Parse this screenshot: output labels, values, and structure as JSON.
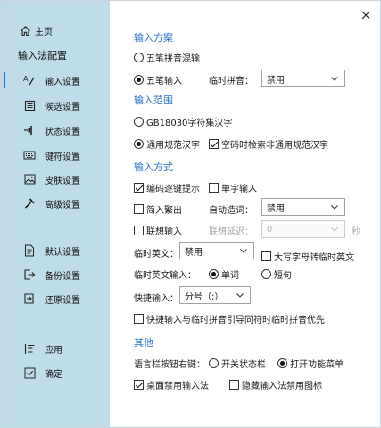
{
  "window": {
    "close_symbol": "×"
  },
  "sidebar": {
    "home": {
      "label": "主页",
      "icon": "home-icon"
    },
    "section_title": "输入法配置",
    "items": [
      {
        "label": "输入设置",
        "icon": "input-settings-icon",
        "active": true
      },
      {
        "label": "候选设置",
        "icon": "candidate-settings-icon"
      },
      {
        "label": "状态设置",
        "icon": "status-settings-icon"
      },
      {
        "label": "键符设置",
        "icon": "keyboard-icon"
      },
      {
        "label": "皮肤设置",
        "icon": "skin-image-icon"
      },
      {
        "label": "高级设置",
        "icon": "hammer-icon"
      }
    ],
    "actions": [
      {
        "label": "默认设置",
        "icon": "default-doc-icon"
      },
      {
        "label": "备份设置",
        "icon": "backup-export-icon"
      },
      {
        "label": "还原设置",
        "icon": "restore-import-icon"
      }
    ],
    "bottom": [
      {
        "label": "应用",
        "icon": "apply-list-icon"
      },
      {
        "label": "确定",
        "icon": "confirm-check-icon"
      }
    ],
    "accent_color": "#1f6fd6",
    "background_color": "#bedcea"
  },
  "scheme": {
    "title": "输入方案",
    "option_mixed": "五笔拼音混输",
    "option_wubi": "五笔输入",
    "temp_pinyin_label": "临时拼音：",
    "temp_pinyin_value": "禁用"
  },
  "range": {
    "title": "输入范围",
    "option_gb18030": "GB18030字符集汉字",
    "option_common": "通用规范汉字",
    "space_search": "空码时检索非通用规范汉字"
  },
  "method": {
    "title": "输入方式",
    "code_hint": "编码逐键提示",
    "single_char": "单字输入",
    "simplified_traditional": "简入繁出",
    "auto_create_word_label": "自动造词：",
    "auto_create_word_value": "禁用",
    "association": "联想输入",
    "association_delay_label": "联想延迟：",
    "association_delay_value": "0",
    "association_delay_unit": "秒",
    "temp_english_label": "临时英文：",
    "temp_english_value": "禁用",
    "caps_temp_english": "大写字母转临时英文",
    "temp_english_input_label": "临时英文输入：",
    "option_word": "单词",
    "option_phrase": "短句",
    "quick_input_label": "快捷输入：",
    "quick_input_value": "分号（;）",
    "quick_input_priority": "快捷输入与临时拼音引导同符时临时拼音优先"
  },
  "other": {
    "title": "其他",
    "lang_bar_right_label": "语言栏按钮右键：",
    "option_toggle_status": "开关状态栏",
    "option_open_menu": "打开功能菜单",
    "desktop_disable": "桌面禁用输入法",
    "hide_disable_icon": "隐藏输入法禁用图标"
  },
  "colors": {
    "group_title": "#2a72c4"
  }
}
